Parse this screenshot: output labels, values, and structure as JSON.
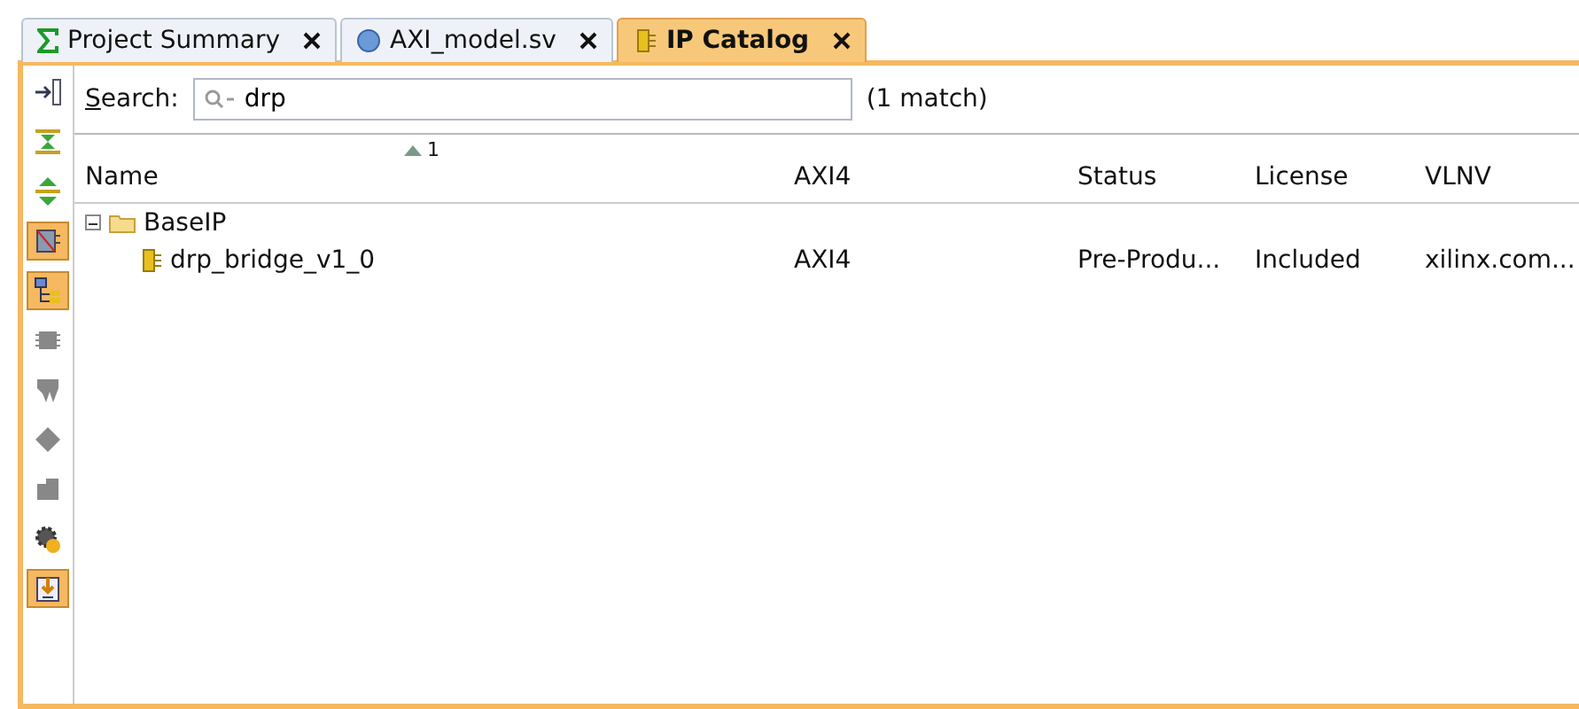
{
  "tabs": [
    {
      "label": "Project Summary",
      "kind": "sigma",
      "selected": false
    },
    {
      "label": "AXI_model.sv",
      "kind": "sv",
      "selected": false
    },
    {
      "label": "IP Catalog",
      "kind": "chip",
      "selected": true
    }
  ],
  "toolbar": [
    {
      "kind": "dock",
      "selected": false
    },
    {
      "kind": "collapse",
      "selected": false
    },
    {
      "kind": "expand",
      "selected": false
    },
    {
      "kind": "filter",
      "selected": true
    },
    {
      "kind": "hierarchy",
      "selected": true
    },
    {
      "kind": "chip",
      "selected": false
    },
    {
      "kind": "tooth",
      "selected": false
    },
    {
      "kind": "diamond",
      "selected": false
    },
    {
      "kind": "block",
      "selected": false
    },
    {
      "kind": "gear",
      "selected": false
    },
    {
      "kind": "download",
      "selected": true
    }
  ],
  "search": {
    "label": "Search:",
    "value": "drp",
    "matches": "(1 match)"
  },
  "table": {
    "sort_order": "1",
    "columns": [
      "Name",
      "AXI4",
      "Status",
      "License",
      "VLNV"
    ],
    "tree": [
      {
        "name": "BaseIP",
        "expanded": true,
        "children": [
          {
            "name": "drp_bridge_v1_0",
            "cells": [
              "AXI4",
              "Pre-Produ...",
              "Included",
              "xilinx.com..."
            ]
          }
        ]
      }
    ]
  }
}
